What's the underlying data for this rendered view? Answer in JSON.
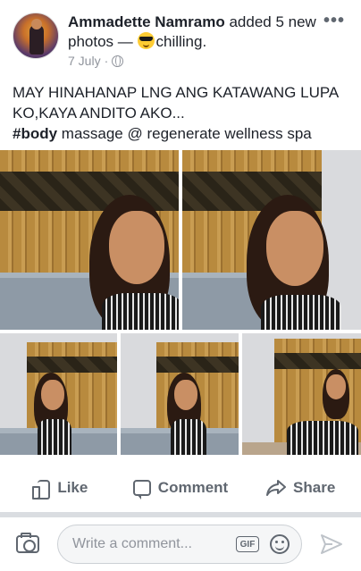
{
  "post": {
    "author": "Ammadette Namramo",
    "action_text": " added 5 new photos — ",
    "feeling_icon": "cool-sunglasses-emoji",
    "feeling": "chilling.",
    "date": "7 July",
    "date_separator": "·",
    "privacy_icon": "globe-icon",
    "more_icon": "•••",
    "text_line1": "MAY HINAHANAP LNG ANG KATAWANG LUPA KO,KAYA ANDITO AKO...",
    "hashtag": "#body",
    "text_line2_rest": " massage @ regenerate wellness spa"
  },
  "photos": [
    {
      "icon": "photo"
    },
    {
      "icon": "photo"
    },
    {
      "icon": "photo"
    },
    {
      "icon": "photo"
    },
    {
      "icon": "photo"
    }
  ],
  "actions": {
    "like_label": "Like",
    "comment_label": "Comment",
    "share_label": "Share"
  },
  "composer": {
    "placeholder": "Write a comment...",
    "gif_label": "GIF"
  },
  "colors": {
    "text": "#1d2129",
    "secondary": "#606770",
    "meta": "#90949c",
    "divider": "#dadde1"
  }
}
